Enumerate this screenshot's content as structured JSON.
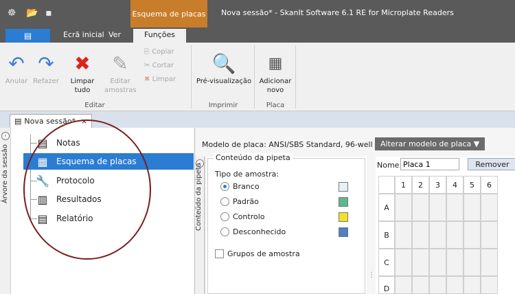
{
  "titlebar": {
    "context_tab": "Esquema de placas",
    "window_title": "Nova sessão* - SkanIt Software 6.1 RE for Microplate Readers"
  },
  "menu": {
    "tabs": [
      {
        "label": "Ecrã inicial"
      },
      {
        "label": "Ver"
      },
      {
        "label": "Funções"
      }
    ]
  },
  "ribbon": {
    "undo": "Anular",
    "redo": "Refazer",
    "clear_all_1": "Limpar",
    "clear_all_2": "tudo",
    "edit_samples_1": "Editar",
    "edit_samples_2": "amostras",
    "copy": "Copiar",
    "cut": "Cortar",
    "clear": "Limpar",
    "preview": "Pré-visualização",
    "add_new_1": "Adicionar",
    "add_new_2": "novo",
    "group_edit": "Editar",
    "group_print": "Imprimir",
    "group_plate": "Placa"
  },
  "doc_tab": {
    "label": "Nova sessão*",
    "close": "×"
  },
  "session_tree": {
    "strip_label": "Árvore da sessão",
    "items": [
      {
        "label": "Notas",
        "icon": "notes-icon"
      },
      {
        "label": "Esquema de placas",
        "icon": "plate-layout-icon",
        "selected": true
      },
      {
        "label": "Protocolo",
        "icon": "protocol-icon"
      },
      {
        "label": "Resultados",
        "icon": "results-icon"
      },
      {
        "label": "Relatório",
        "icon": "report-icon"
      }
    ]
  },
  "layout_panel": {
    "plate_model_label": "Modelo de placa:",
    "plate_model_value": "ANSI/SBS Standard, 96-well",
    "change_model_button": "Alterar modelo de placa ▼",
    "pipette_strip_label": "Conteúdo da pipeta",
    "pipette_group_title": "Conteúdo da pipeta",
    "sample_type_label": "Tipo de amostra:",
    "sample_types": [
      {
        "label": "Branco",
        "color": "#e8f0f4",
        "checked": true
      },
      {
        "label": "Padrão",
        "color": "#5cb88f",
        "checked": false
      },
      {
        "label": "Controlo",
        "color": "#f2e12a",
        "checked": false
      },
      {
        "label": "Desconhecido",
        "color": "#4f7fc4",
        "checked": false
      }
    ],
    "sample_groups_label": "Grupos de amostra",
    "name_label": "Nome:",
    "name_value": "Placa 1",
    "remove_button": "Remover",
    "columns": [
      "1",
      "2",
      "3",
      "4",
      "5",
      "6"
    ],
    "rows": [
      "A",
      "B",
      "C",
      "D"
    ]
  }
}
